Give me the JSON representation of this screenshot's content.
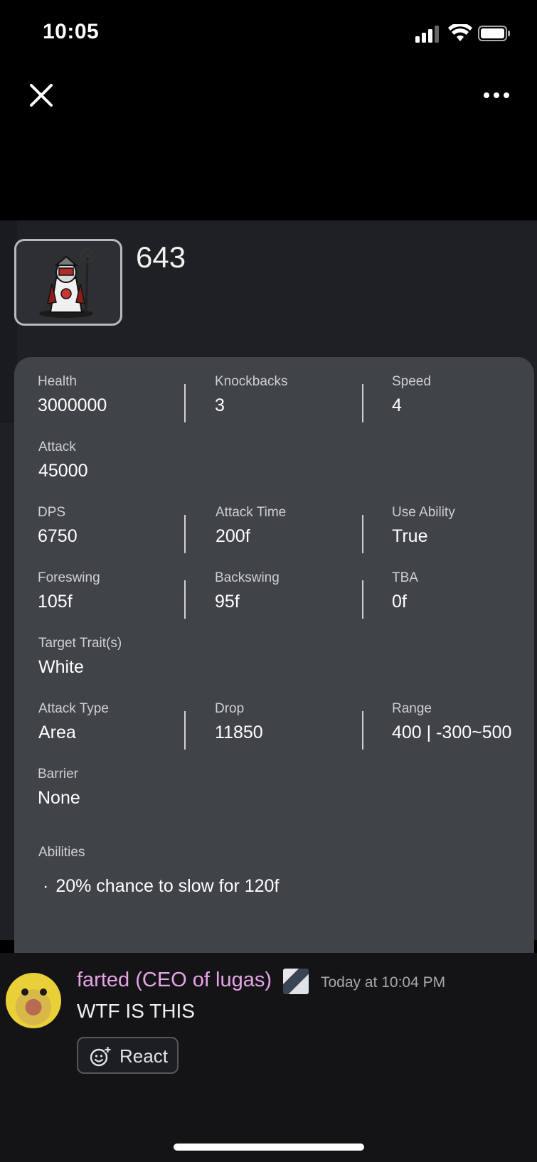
{
  "status_bar": {
    "time": "10:05"
  },
  "toolbar": {
    "close_icon": "close-icon",
    "more_icon": "more-options-icon"
  },
  "unit": {
    "name": "643"
  },
  "stats": {
    "row1": [
      {
        "label": "Health",
        "value": "3000000"
      },
      {
        "label": "Knockbacks",
        "value": "3"
      },
      {
        "label": "Speed",
        "value": "4"
      }
    ],
    "row2": [
      {
        "label": "Attack",
        "value": "45000"
      }
    ],
    "row3": [
      {
        "label": "DPS",
        "value": "6750"
      },
      {
        "label": "Attack Time",
        "value": "200f"
      },
      {
        "label": "Use Ability",
        "value": "True"
      }
    ],
    "row4": [
      {
        "label": "Foreswing",
        "value": "105f"
      },
      {
        "label": "Backswing",
        "value": "95f"
      },
      {
        "label": "TBA",
        "value": "0f"
      }
    ],
    "row5": [
      {
        "label": "Target Trait(s)",
        "value": "White"
      }
    ],
    "row6": [
      {
        "label": "Attack Type",
        "value": "Area"
      },
      {
        "label": "Drop",
        "value": "11850"
      },
      {
        "label": "Range",
        "value": "400 | -300~500"
      }
    ],
    "row7": [
      {
        "label": "Barrier",
        "value": "None"
      }
    ],
    "abilities_title": "Abilities",
    "abilities": [
      {
        "bullet": "·",
        "text": "20% chance to slow for 120f"
      }
    ]
  },
  "message": {
    "username": "farted (CEO of lugas)",
    "timestamp": "Today at 10:04 PM",
    "text": "WTF IS THIS",
    "react_label": "React",
    "username_color": "#e6a4e6"
  }
}
